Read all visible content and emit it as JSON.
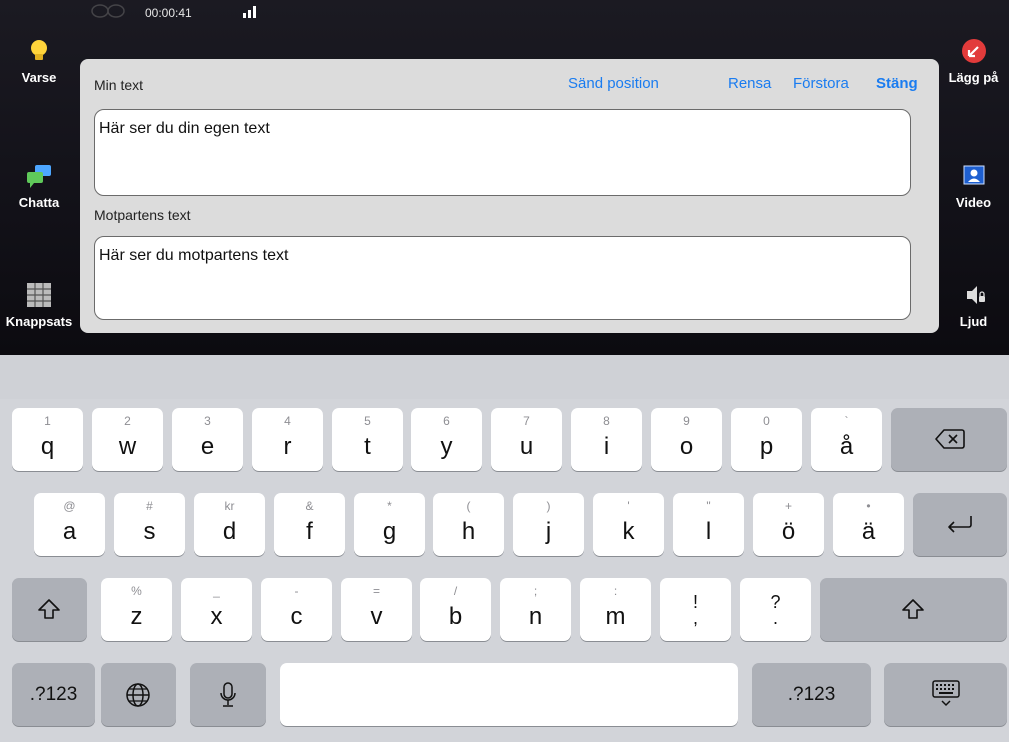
{
  "status": {
    "timer": "00:00:41"
  },
  "left_sidebar": [
    {
      "label": "Varse",
      "icon": "lightbulb-icon"
    },
    {
      "label": "Chatta",
      "icon": "chat-bubbles-icon"
    },
    {
      "label": "Knappsats",
      "icon": "keypad-icon"
    }
  ],
  "right_sidebar": [
    {
      "label": "Lägg på",
      "icon": "hang-up-icon"
    },
    {
      "label": "Video",
      "icon": "video-user-icon"
    },
    {
      "label": "Ljud",
      "icon": "speaker-icon"
    }
  ],
  "panel": {
    "my_label": "Min text",
    "send_position": "Sänd position",
    "clear": "Rensa",
    "enlarge": "Förstora",
    "close": "Stäng",
    "my_text": "Här ser du din egen text",
    "other_label": "Motpartens text",
    "other_text": "Här ser du motpartens text"
  },
  "keyboard": {
    "row1": [
      {
        "k": "q",
        "s": "1"
      },
      {
        "k": "w",
        "s": "2"
      },
      {
        "k": "e",
        "s": "3"
      },
      {
        "k": "r",
        "s": "4"
      },
      {
        "k": "t",
        "s": "5"
      },
      {
        "k": "y",
        "s": "6"
      },
      {
        "k": "u",
        "s": "7"
      },
      {
        "k": "i",
        "s": "8"
      },
      {
        "k": "o",
        "s": "9"
      },
      {
        "k": "p",
        "s": "0"
      },
      {
        "k": "å",
        "s": "`"
      }
    ],
    "row2": [
      {
        "k": "a",
        "s": "@"
      },
      {
        "k": "s",
        "s": "#"
      },
      {
        "k": "d",
        "s": "kr"
      },
      {
        "k": "f",
        "s": "&"
      },
      {
        "k": "g",
        "s": "*"
      },
      {
        "k": "h",
        "s": "("
      },
      {
        "k": "j",
        "s": ")"
      },
      {
        "k": "k",
        "s": "'"
      },
      {
        "k": "l",
        "s": "\""
      },
      {
        "k": "ö",
        "s": "+"
      },
      {
        "k": "ä",
        "s": "•"
      }
    ],
    "row3": [
      {
        "k": "z",
        "s": "%"
      },
      {
        "k": "x",
        "s": "_"
      },
      {
        "k": "c",
        "s": "-"
      },
      {
        "k": "v",
        "s": "="
      },
      {
        "k": "b",
        "s": "/"
      },
      {
        "k": "n",
        "s": ";"
      },
      {
        "k": "m",
        "s": ":"
      }
    ],
    "row3_punct": [
      {
        "top": "!",
        "bottom": ","
      },
      {
        "top": "?",
        "bottom": "."
      }
    ],
    "numbers_label": ".?123"
  }
}
